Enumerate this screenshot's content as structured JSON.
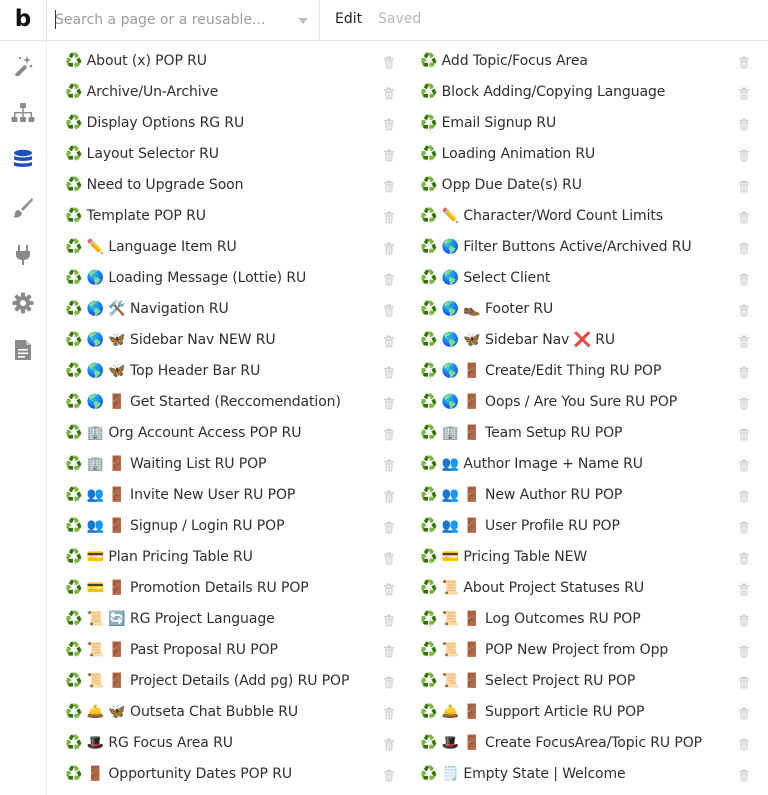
{
  "topbar": {
    "logo": "b",
    "search_placeholder": "Search a page or a reusable...",
    "edit_label": "Edit",
    "saved_label": "Saved"
  },
  "sidebar": {
    "items": [
      {
        "name": "design-icon"
      },
      {
        "name": "workflow-icon"
      },
      {
        "name": "data-icon"
      },
      {
        "name": "styles-icon"
      },
      {
        "name": "plugins-icon"
      },
      {
        "name": "settings-icon"
      },
      {
        "name": "logs-icon"
      }
    ],
    "active_color": "#1d4fbf",
    "inactive_color": "#8a8a8a"
  },
  "list": {
    "left": [
      "♻️ About (x) POP RU",
      "♻️ Archive/Un-Archive",
      "♻️ Display Options RG RU",
      "♻️ Layout Selector RU",
      "♻️ Need to Upgrade Soon",
      "♻️ Template POP RU",
      "♻️ ✏️ Language Item RU",
      "♻️ 🌎 Loading Message (Lottie) RU",
      "♻️ 🌎 🛠️ Navigation RU",
      "♻️ 🌎 🦋 Sidebar Nav NEW RU",
      "♻️ 🌎 🦋 Top Header Bar RU",
      "♻️ 🌎 🚪 Get Started (Reccomendation)",
      "♻️ 🏢 Org Account Access POP RU",
      "♻️ 🏢 🚪 Waiting List RU POP",
      "♻️ 👥 🚪 Invite New User RU POP",
      "♻️ 👥 🚪 Signup / Login RU POP",
      "♻️ 💳 Plan Pricing Table RU",
      "♻️ 💳 🚪 Promotion Details RU POP",
      "♻️ 📜 🔄 RG Project Language",
      "♻️ 📜 🚪 Past Proposal RU POP",
      "♻️ 📜 🚪 Project Details (Add pg) RU POP",
      "♻️ 🛎️ 🦋 Outseta Chat Bubble RU",
      "♻️ 🎩 RG Focus Area RU",
      "♻️ 🚪 Opportunity Dates POP RU"
    ],
    "right": [
      "♻️ Add Topic/Focus Area",
      "♻️ Block Adding/Copying Language",
      "♻️ Email Signup RU",
      "♻️ Loading Animation RU",
      "♻️ Opp Due Date(s) RU",
      "♻️ ✏️ Character/Word Count Limits",
      "♻️ 🌎 Filter Buttons Active/Archived RU",
      "♻️ 🌎 Select Client",
      "♻️ 🌎 👞 Footer RU",
      "♻️ 🌎 🦋 Sidebar Nav ❌ RU",
      "♻️ 🌎 🚪 Create/Edit Thing RU POP",
      "♻️ 🌎 🚪 Oops / Are You Sure RU POP",
      "♻️ 🏢 🚪 Team Setup RU POP",
      "♻️ 👥 Author Image + Name RU",
      "♻️ 👥 🚪 New Author RU POP",
      "♻️ 👥 🚪 User Profile RU POP",
      "♻️ 💳 Pricing Table NEW",
      "♻️ 📜 About Project Statuses RU",
      "♻️ 📜 🚪 Log Outcomes RU POP",
      "♻️ 📜 🚪 POP New Project from Opp",
      "♻️ 📜 🚪 Select Project RU POP",
      "♻️ 🛎️ 🚪 Support Article RU POP",
      "♻️ 🎩 🚪 Create FocusArea/Topic RU POP",
      "♻️ 🗒️ Empty State | Welcome"
    ]
  }
}
